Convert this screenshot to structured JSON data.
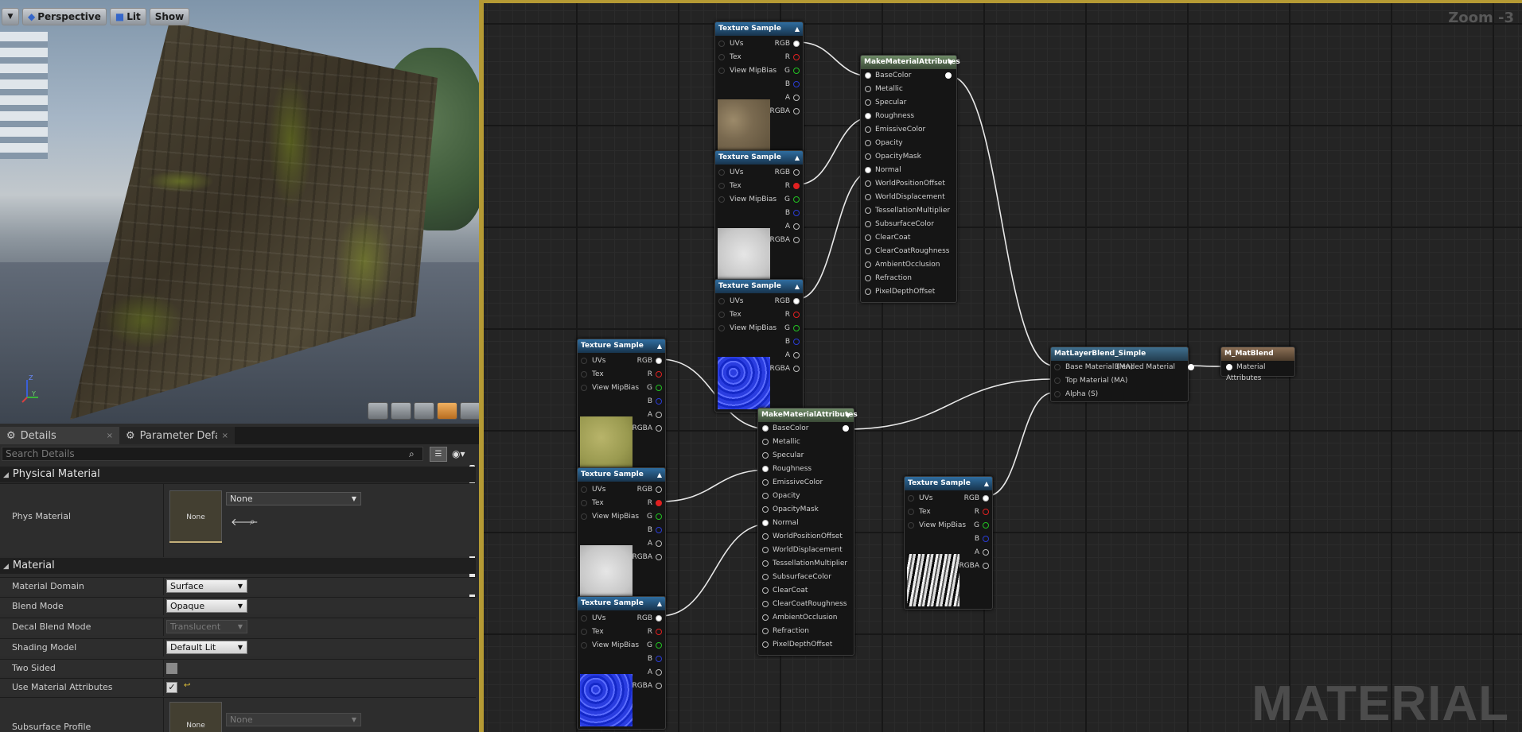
{
  "viewport": {
    "mode": "Perspective",
    "lighting": "Lit",
    "show": "Show",
    "menu_icon": "chevron-down-icon",
    "axis": {
      "z": "Z",
      "y": "Y",
      "x": "X"
    }
  },
  "tabs": [
    {
      "label": "Details"
    },
    {
      "label": "Parameter Defaults"
    }
  ],
  "search": {
    "placeholder": "Search Details"
  },
  "categories": {
    "physical": "Physical Material",
    "material": "Material"
  },
  "props": {
    "phys_material": {
      "label": "Phys Material",
      "thumb": "None",
      "value": "None"
    },
    "material_domain": {
      "label": "Material Domain",
      "value": "Surface"
    },
    "blend_mode": {
      "label": "Blend Mode",
      "value": "Opaque"
    },
    "decal_blend_mode": {
      "label": "Decal Blend Mode",
      "value": "Translucent"
    },
    "shading_model": {
      "label": "Shading Model",
      "value": "Default Lit"
    },
    "two_sided": {
      "label": "Two Sided",
      "checked": false
    },
    "use_material_attributes": {
      "label": "Use Material Attributes",
      "checked": true
    },
    "subsurface_profile": {
      "label": "Subsurface Profile",
      "thumb": "None",
      "value": "None"
    }
  },
  "graph": {
    "zoom": "Zoom -3",
    "watermark": "MATERIAL"
  },
  "texture_sample": {
    "title": "Texture Sample",
    "inputs": [
      "UVs",
      "Tex",
      "View MipBias"
    ],
    "outputs": [
      "RGB",
      "R",
      "G",
      "B",
      "A",
      "RGBA"
    ]
  },
  "make_attrs": {
    "title": "MakeMaterialAttributes",
    "inputs": [
      "BaseColor",
      "Metallic",
      "Specular",
      "Roughness",
      "EmissiveColor",
      "Opacity",
      "OpacityMask",
      "Normal",
      "WorldPositionOffset",
      "WorldDisplacement",
      "TessellationMultiplier",
      "SubsurfaceColor",
      "ClearCoat",
      "ClearCoatRoughness",
      "AmbientOcclusion",
      "Refraction",
      "PixelDepthOffset"
    ]
  },
  "layer_blend": {
    "title": "MatLayerBlend_Simple",
    "inputs": [
      "Base Material (MA)",
      "Top Material (MA)",
      "Alpha (S)"
    ],
    "output": "Blended Material"
  },
  "result": {
    "title": "M_MatBlend",
    "input": "Material Attributes"
  },
  "colors": {
    "accent_border": "#b59a34",
    "texture_header": "#2f6da0",
    "attrs_header": "#6d8a66",
    "pin_red": "#e02020",
    "pin_green": "#22c222",
    "pin_blue": "#2a3cd4"
  }
}
